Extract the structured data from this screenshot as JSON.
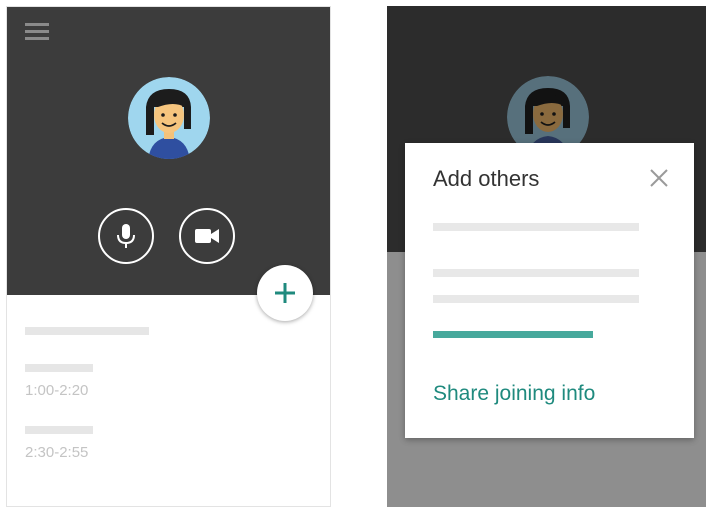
{
  "schedule": {
    "slots": [
      {
        "time": "1:00-2:20"
      },
      {
        "time": "2:30-2:55"
      }
    ]
  },
  "dialog": {
    "title": "Add others",
    "share_label": "Share joining info"
  },
  "icons": {
    "menu": "menu-icon",
    "mic": "microphone-icon",
    "video": "video-camera-icon",
    "add": "plus-icon",
    "close": "close-icon"
  },
  "colors": {
    "dark_header": "#3c3c3c",
    "accent": "#1f8a7e",
    "accent_bar": "#47a99c"
  }
}
